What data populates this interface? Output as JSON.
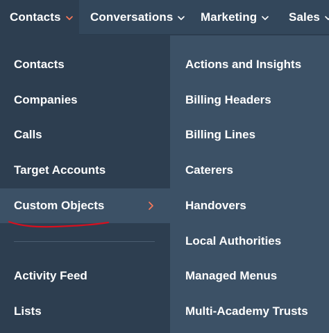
{
  "topnav": {
    "items": [
      {
        "label": "Contacts",
        "active": true
      },
      {
        "label": "Conversations",
        "active": false
      },
      {
        "label": "Marketing",
        "active": false
      },
      {
        "label": "Sales",
        "active": false
      }
    ]
  },
  "menu": {
    "left": [
      {
        "label": "Contacts"
      },
      {
        "label": "Companies"
      },
      {
        "label": "Calls"
      },
      {
        "label": "Target Accounts"
      },
      {
        "label": "Custom Objects",
        "highlighted": true,
        "has_submenu": true
      },
      {
        "label": "Activity Feed"
      },
      {
        "label": "Lists"
      }
    ],
    "right": [
      {
        "label": "Actions and Insights"
      },
      {
        "label": "Billing Headers"
      },
      {
        "label": "Billing Lines"
      },
      {
        "label": "Caterers"
      },
      {
        "label": "Handovers"
      },
      {
        "label": "Local Authorities"
      },
      {
        "label": "Managed Menus"
      },
      {
        "label": "Multi-Academy Trusts"
      }
    ]
  },
  "colors": {
    "nav_bg": "#33475b",
    "menu_bg": "#2d3e50",
    "submenu_bg": "#3c5166",
    "accent": "#ff7a59",
    "annotation": "#d6101f"
  },
  "icons": {
    "active_chevron": "chevron-down-icon",
    "submenu_arrow": "chevron-right-icon"
  }
}
